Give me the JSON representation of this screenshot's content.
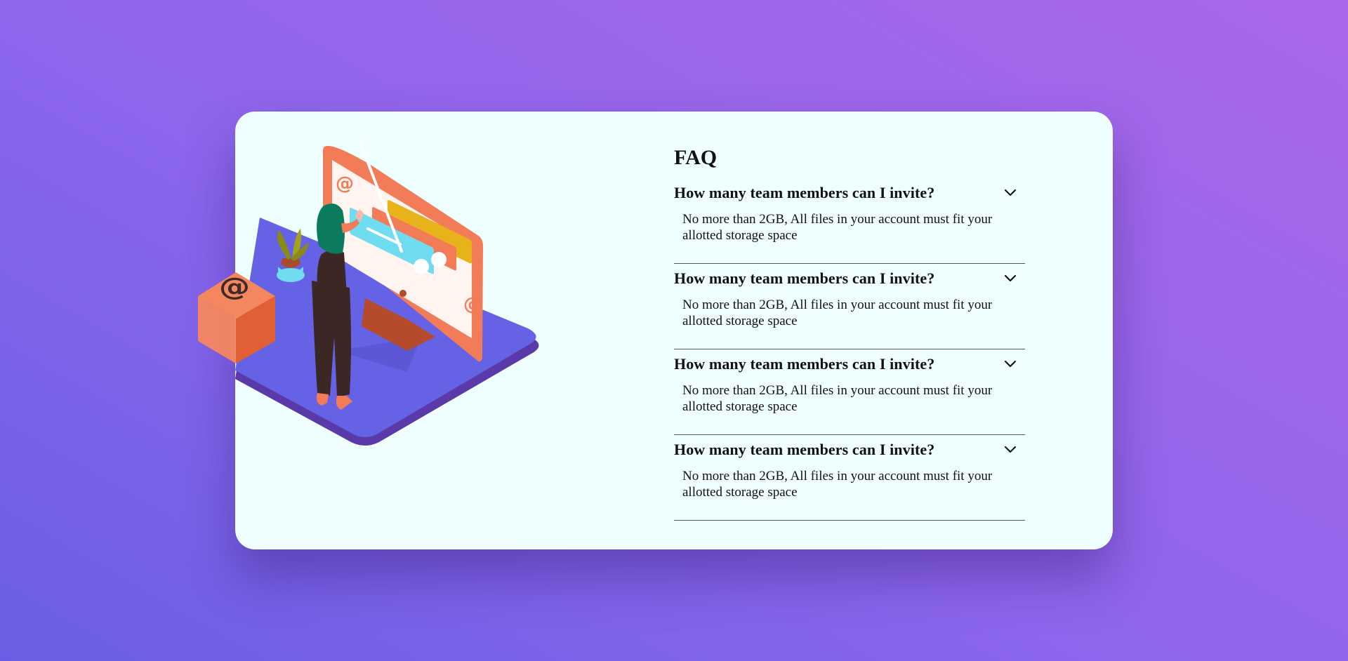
{
  "faq": {
    "title": "FAQ",
    "items": [
      {
        "question": "How many team members can I invite?",
        "answer": "No more than 2GB, All files in your account must fit your allotted storage space",
        "icon": "chevron-down-icon"
      },
      {
        "question": "How many team members can I invite?",
        "answer": "No more than 2GB, All files in your account must fit your allotted storage space",
        "icon": "chevron-down-icon"
      },
      {
        "question": "How many team members can I invite?",
        "answer": "No more than 2GB, All files in your account must fit your allotted storage space",
        "icon": "chevron-down-icon"
      },
      {
        "question": "How many team members can I invite?",
        "answer": "No more than 2GB, All files in your account must fit your allotted storage space",
        "icon": "chevron-down-icon"
      }
    ]
  },
  "colors": {
    "background_start": "#6a5fe4",
    "background_end": "#ab66ea",
    "card": "#effefe",
    "platform": "#6662e5",
    "monitor": "#f27b58",
    "box": "#f5875f"
  }
}
